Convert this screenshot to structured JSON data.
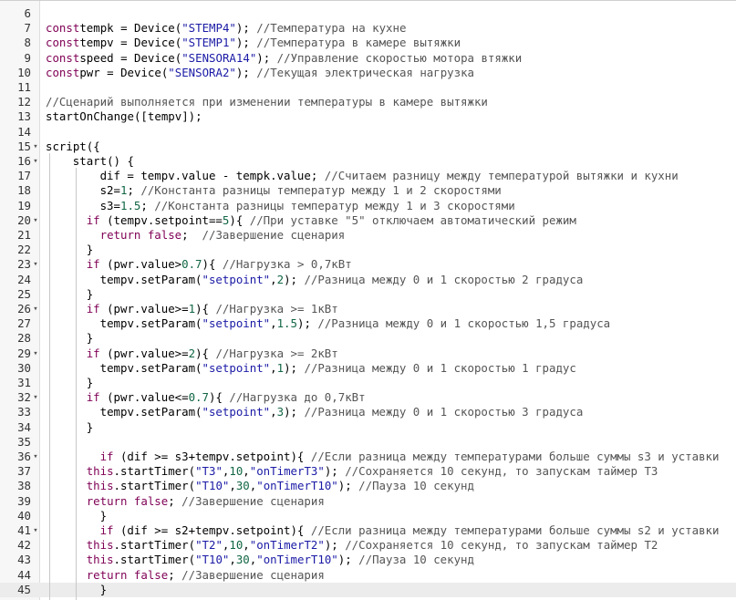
{
  "editor": {
    "colors": {
      "keyword": "#7f0055",
      "string": "#1a1aa6",
      "number": "#116644",
      "comment": "#555555",
      "gutter_bg": "#f7f7f7",
      "current_line_bg": "#ececec"
    },
    "fold_marker_icon": "fold-arrow-down-icon",
    "lines": [
      {
        "n": "6",
        "indent": 0,
        "fold": false,
        "tokens": []
      },
      {
        "n": "7",
        "indent": 0,
        "fold": false,
        "tokens": [
          [
            "kw",
            "const"
          ],
          [
            "",
            "tempk = Device("
          ],
          [
            "str",
            "\"STEMP4\""
          ],
          [
            "",
            "); "
          ],
          [
            "cmt",
            "//Температура на кухне"
          ]
        ]
      },
      {
        "n": "8",
        "indent": 0,
        "fold": false,
        "tokens": [
          [
            "kw",
            "const"
          ],
          [
            "",
            "tempv = Device("
          ],
          [
            "str",
            "\"STEMP1\""
          ],
          [
            "",
            "); "
          ],
          [
            "cmt",
            "//Температура в камере вытяжки"
          ]
        ]
      },
      {
        "n": "9",
        "indent": 0,
        "fold": false,
        "tokens": [
          [
            "kw",
            "const"
          ],
          [
            "",
            "speed = Device("
          ],
          [
            "str",
            "\"SENSORA14\""
          ],
          [
            "",
            "); "
          ],
          [
            "cmt",
            "//Управление скоростью мотора втяжки"
          ]
        ]
      },
      {
        "n": "10",
        "indent": 0,
        "fold": false,
        "tokens": [
          [
            "kw",
            "const"
          ],
          [
            "",
            "pwr = Device("
          ],
          [
            "str",
            "\"SENSORA2\""
          ],
          [
            "",
            "); "
          ],
          [
            "cmt",
            "//Текущая электрическая нагрузка"
          ]
        ]
      },
      {
        "n": "11",
        "indent": 0,
        "fold": false,
        "tokens": []
      },
      {
        "n": "12",
        "indent": 0,
        "fold": false,
        "tokens": [
          [
            "cmt",
            "//Сценарий выполняется при изменении температуры в камере вытяжки"
          ]
        ]
      },
      {
        "n": "13",
        "indent": 0,
        "fold": false,
        "tokens": [
          [
            "",
            "startOnChange([tempv]);"
          ]
        ]
      },
      {
        "n": "14",
        "indent": 0,
        "fold": false,
        "tokens": []
      },
      {
        "n": "15",
        "indent": 0,
        "fold": true,
        "tokens": [
          [
            "",
            "script({"
          ]
        ]
      },
      {
        "n": "16",
        "indent": 4,
        "fold": true,
        "tokens": [
          [
            "",
            "start() {"
          ]
        ]
      },
      {
        "n": "17",
        "indent": 8,
        "fold": false,
        "tokens": [
          [
            "",
            "dif = tempv.value - tempk.value; "
          ],
          [
            "cmt",
            "//Считаем разницу между температурой вытяжки и кухни"
          ]
        ]
      },
      {
        "n": "18",
        "indent": 8,
        "fold": false,
        "tokens": [
          [
            "",
            "s2="
          ],
          [
            "num",
            "1"
          ],
          [
            "",
            "; "
          ],
          [
            "cmt",
            "//Константа разницы температур между 1 и 2 скоростями"
          ]
        ]
      },
      {
        "n": "19",
        "indent": 8,
        "fold": false,
        "tokens": [
          [
            "",
            "s3="
          ],
          [
            "num",
            "1.5"
          ],
          [
            "",
            "; "
          ],
          [
            "cmt",
            "//Константа разницы температур между 1 и 3 скоростями"
          ]
        ]
      },
      {
        "n": "20",
        "indent": 6,
        "fold": true,
        "tokens": [
          [
            "kw",
            "if"
          ],
          [
            "",
            " (tempv.setpoint=="
          ],
          [
            "num",
            "5"
          ],
          [
            "",
            "){ "
          ],
          [
            "cmt",
            "//При уставке \"5\" отключаем автоматический режим"
          ]
        ]
      },
      {
        "n": "21",
        "indent": 6,
        "fold": false,
        "tokens": [
          [
            "",
            "  "
          ],
          [
            "kw",
            "return"
          ],
          [
            "",
            " "
          ],
          [
            "kw",
            "false"
          ],
          [
            "",
            ";  "
          ],
          [
            "cmt",
            "//Завершение сценария"
          ]
        ]
      },
      {
        "n": "22",
        "indent": 6,
        "fold": false,
        "tokens": [
          [
            "",
            "}"
          ]
        ]
      },
      {
        "n": "23",
        "indent": 6,
        "fold": true,
        "tokens": [
          [
            "kw",
            "if"
          ],
          [
            "",
            " (pwr.value>"
          ],
          [
            "num",
            "0.7"
          ],
          [
            "",
            "){ "
          ],
          [
            "cmt",
            "//Нагрузка > 0,7кВт"
          ]
        ]
      },
      {
        "n": "24",
        "indent": 6,
        "fold": false,
        "tokens": [
          [
            "",
            "  tempv.setParam("
          ],
          [
            "str",
            "\"setpoint\""
          ],
          [
            "",
            ","
          ],
          [
            "num",
            "2"
          ],
          [
            "",
            "); "
          ],
          [
            "cmt",
            "//Разница между 0 и 1 скоростью 2 градуса"
          ]
        ]
      },
      {
        "n": "25",
        "indent": 6,
        "fold": false,
        "tokens": [
          [
            "",
            "}"
          ]
        ]
      },
      {
        "n": "26",
        "indent": 6,
        "fold": true,
        "tokens": [
          [
            "kw",
            "if"
          ],
          [
            "",
            " (pwr.value>="
          ],
          [
            "num",
            "1"
          ],
          [
            "",
            "){ "
          ],
          [
            "cmt",
            "//Нагрузка >= 1кВт"
          ]
        ]
      },
      {
        "n": "27",
        "indent": 6,
        "fold": false,
        "tokens": [
          [
            "",
            "  tempv.setParam("
          ],
          [
            "str",
            "\"setpoint\""
          ],
          [
            "",
            ","
          ],
          [
            "num",
            "1.5"
          ],
          [
            "",
            "); "
          ],
          [
            "cmt",
            "//Разница между 0 и 1 скоростью 1,5 градуса"
          ]
        ]
      },
      {
        "n": "28",
        "indent": 6,
        "fold": false,
        "tokens": [
          [
            "",
            "}"
          ]
        ]
      },
      {
        "n": "29",
        "indent": 6,
        "fold": true,
        "tokens": [
          [
            "kw",
            "if"
          ],
          [
            "",
            " (pwr.value>="
          ],
          [
            "num",
            "2"
          ],
          [
            "",
            "){ "
          ],
          [
            "cmt",
            "//Нагрузка >= 2кВт"
          ]
        ]
      },
      {
        "n": "30",
        "indent": 6,
        "fold": false,
        "tokens": [
          [
            "",
            "  tempv.setParam("
          ],
          [
            "str",
            "\"setpoint\""
          ],
          [
            "",
            ","
          ],
          [
            "num",
            "1"
          ],
          [
            "",
            "); "
          ],
          [
            "cmt",
            "//Разница между 0 и 1 скоростью 1 градус"
          ]
        ]
      },
      {
        "n": "31",
        "indent": 6,
        "fold": false,
        "tokens": [
          [
            "",
            "}"
          ]
        ]
      },
      {
        "n": "32",
        "indent": 6,
        "fold": true,
        "tokens": [
          [
            "kw",
            "if"
          ],
          [
            "",
            " (pwr.value<="
          ],
          [
            "num",
            "0.7"
          ],
          [
            "",
            "){ "
          ],
          [
            "cmt",
            "//Нагрузка до 0,7кВт"
          ]
        ]
      },
      {
        "n": "33",
        "indent": 6,
        "fold": false,
        "tokens": [
          [
            "",
            "  tempv.setParam("
          ],
          [
            "str",
            "\"setpoint\""
          ],
          [
            "",
            ","
          ],
          [
            "num",
            "3"
          ],
          [
            "",
            "); "
          ],
          [
            "cmt",
            "//Разница между 0 и 1 скоростью 3 градуса"
          ]
        ]
      },
      {
        "n": "34",
        "indent": 6,
        "fold": false,
        "tokens": [
          [
            "",
            "}"
          ]
        ]
      },
      {
        "n": "35",
        "indent": 0,
        "fold": false,
        "tokens": []
      },
      {
        "n": "36",
        "indent": 8,
        "fold": true,
        "tokens": [
          [
            "kw",
            "if"
          ],
          [
            "",
            " (dif >= s3+tempv.setpoint){ "
          ],
          [
            "cmt",
            "//Если разница между температурами больше суммы s3 и уставки"
          ]
        ]
      },
      {
        "n": "37",
        "indent": 6,
        "fold": false,
        "tokens": [
          [
            "kw",
            "this"
          ],
          [
            "",
            ".startTimer("
          ],
          [
            "str",
            "\"T3\""
          ],
          [
            "",
            ","
          ],
          [
            "num",
            "10"
          ],
          [
            "",
            ","
          ],
          [
            "str",
            "\"onTimerT3\""
          ],
          [
            "",
            "); "
          ],
          [
            "cmt",
            "//Сохраняется 10 секунд, то запускам таймер Т3"
          ]
        ]
      },
      {
        "n": "38",
        "indent": 6,
        "fold": false,
        "tokens": [
          [
            "kw",
            "this"
          ],
          [
            "",
            ".startTimer("
          ],
          [
            "str",
            "\"T10\""
          ],
          [
            "",
            ","
          ],
          [
            "num",
            "30"
          ],
          [
            "",
            ","
          ],
          [
            "str",
            "\"onTimerT10\""
          ],
          [
            "",
            "); "
          ],
          [
            "cmt",
            "//Пауза 10 секунд"
          ]
        ]
      },
      {
        "n": "39",
        "indent": 6,
        "fold": false,
        "tokens": [
          [
            "kw",
            "return"
          ],
          [
            "",
            " "
          ],
          [
            "kw",
            "false"
          ],
          [
            "",
            "; "
          ],
          [
            "cmt",
            "//Завершение сценария"
          ]
        ]
      },
      {
        "n": "40",
        "indent": 8,
        "fold": false,
        "tokens": [
          [
            "",
            "}"
          ]
        ]
      },
      {
        "n": "41",
        "indent": 8,
        "fold": true,
        "tokens": [
          [
            "kw",
            "if"
          ],
          [
            "",
            " (dif >= s2+tempv.setpoint){ "
          ],
          [
            "cmt",
            "//Если разница между температурами больше суммы s2 и уставки"
          ]
        ]
      },
      {
        "n": "42",
        "indent": 6,
        "fold": false,
        "tokens": [
          [
            "kw",
            "this"
          ],
          [
            "",
            ".startTimer("
          ],
          [
            "str",
            "\"T2\""
          ],
          [
            "",
            ","
          ],
          [
            "num",
            "10"
          ],
          [
            "",
            ","
          ],
          [
            "str",
            "\"onTimerT2\""
          ],
          [
            "",
            "); "
          ],
          [
            "cmt",
            "//Сохраняется 10 секунд, то запускам таймер Т2"
          ]
        ]
      },
      {
        "n": "43",
        "indent": 6,
        "fold": false,
        "tokens": [
          [
            "kw",
            "this"
          ],
          [
            "",
            ".startTimer("
          ],
          [
            "str",
            "\"T10\""
          ],
          [
            "",
            ","
          ],
          [
            "num",
            "30"
          ],
          [
            "",
            ","
          ],
          [
            "str",
            "\"onTimerT10\""
          ],
          [
            "",
            "); "
          ],
          [
            "cmt",
            "//Пауза 10 секунд"
          ]
        ]
      },
      {
        "n": "44",
        "indent": 6,
        "fold": false,
        "tokens": [
          [
            "kw",
            "return"
          ],
          [
            "",
            " "
          ],
          [
            "kw",
            "false"
          ],
          [
            "",
            "; "
          ],
          [
            "cmt",
            "//Завершение сценария"
          ]
        ]
      },
      {
        "n": "45",
        "indent": 8,
        "fold": false,
        "current": true,
        "tokens": [
          [
            "",
            "}"
          ]
        ]
      }
    ]
  }
}
